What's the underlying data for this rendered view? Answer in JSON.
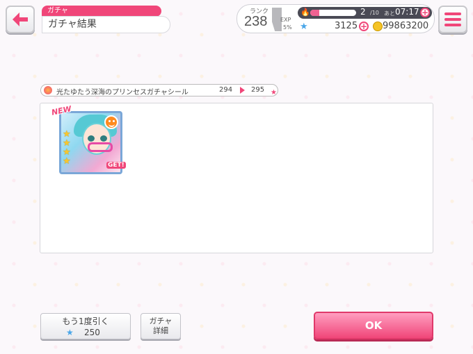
{
  "header": {
    "category": "ガチャ",
    "title": "ガチャ結果"
  },
  "status": {
    "rank_label": "ランク",
    "rank": "238",
    "exp_label": "EXP",
    "exp_percent": "5%",
    "stamina_current": "2",
    "stamina_max": "/10",
    "stamina_timer_label": "あと",
    "stamina_timer": "07:17",
    "stamina_fill": 0.2,
    "stars": "3125",
    "coins": "99863200"
  },
  "gacha": {
    "seal_name": "光たゆたう深海のプリンセスガチャシール",
    "seal_from": "294",
    "seal_to": "295"
  },
  "result": {
    "new_badge": "NEW",
    "get_badge": "GET!",
    "rarity_stars": 4,
    "attribute_color": "#ff8a1f"
  },
  "buttons": {
    "draw_again": "もう1度引く",
    "draw_again_cost": "250",
    "gacha_detail_line1": "ガチャ",
    "gacha_detail_line2": "詳細",
    "ok": "OK"
  },
  "colors": {
    "accent": "#f04679",
    "star_blue": "#4aa6e8",
    "coin_gold": "#f5c426"
  }
}
